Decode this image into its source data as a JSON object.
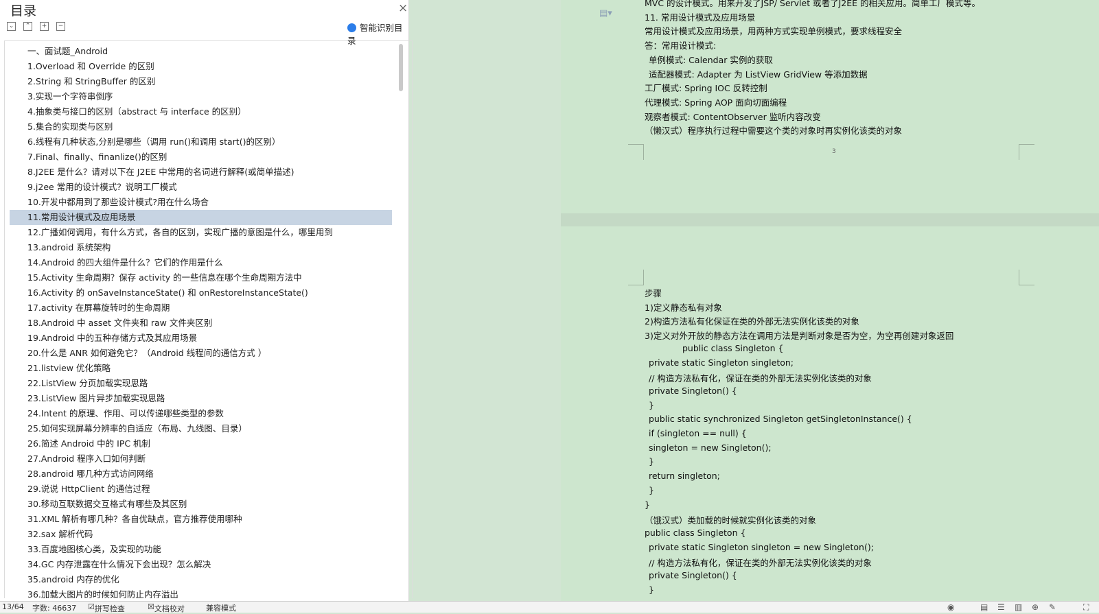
{
  "toc": {
    "title": "目录",
    "close_icon": "×",
    "smart_label": "智能识别目录",
    "toolbar_icons": [
      "collapse-icon",
      "expand-up-icon",
      "plus-icon",
      "minus-icon"
    ],
    "selected_index": 11,
    "items": [
      "一、面试题_Android",
      "1.Overload 和 Override 的区别",
      "2.String  和 StringBuffer 的区别",
      "3.实现一个字符串倒序",
      "4.抽象类与接口的区别（abstract 与 interface 的区别）",
      "5.集合的实现类与区别",
      "6.线程有几种状态,分别是哪些（调用 run()和调用 start()的区别）",
      "7.Final、finally、finanlize()的区别",
      "8.J2EE 是什么？请对以下在 J2EE 中常用的名词进行解释(或简单描述)",
      "9.j2ee 常用的设计模式？说明工厂模式",
      "10.开发中都用到了那些设计模式?用在什么场合",
      "11.常用设计模式及应用场景",
      "12.广播如何调用，有什么方式，各自的区别，实现广播的意图是什么，哪里用到",
      "13.android 系统架构",
      "14.Android 的四大组件是什么？它们的作用是什么",
      "15.Activity 生命周期？保存 activity 的一些信息在哪个生命周期方法中",
      "16.Activity 的  onSaveInstanceState()  和  onRestoreInstanceState()",
      "17.activity 在屏幕旋转时的生命周期",
      "18.Android 中 asset 文件夹和 raw 文件夹区别",
      "19.Android 中的五种存储方式及其应用场景",
      "20.什么是 ANR  如何避免它？（Android 线程间的通信方式  ）",
      "21.listview 优化策略",
      "22.ListView 分页加载实现思路",
      "23.ListView 图片异步加载实现思路",
      "24.Intent 的原理、作用、可以传递哪些类型的参数",
      "25.如何实现屏幕分辨率的自适应（布局、九线图、目录）",
      "26.简述 Android 中的 IPC 机制",
      "27.Android 程序入口如何判断",
      "28.android 哪几种方式访问网络",
      "29.说说 HttpClient 的通信过程",
      "30.移动互联数据交互格式有哪些及其区别",
      "31.XML 解析有哪几种？各自优缺点，官方推荐使用哪种",
      "32.sax 解析代码",
      "33.百度地图核心类，及实现的功能",
      "34.GC 内存泄露在什么情况下会出现？怎么解决",
      "35.android 内存的优化",
      "36.加载大图片的时候如何防止内存溢出"
    ]
  },
  "page1": {
    "page_number": "3",
    "lines": [
      {
        "text": "MVC 的设计模式。用来开发了JSP/ Servlet 或者了J2EE 的相关应用。简单工厂模式等。",
        "indent": 0
      },
      {
        "text": "11.   常用设计模式及应用场景",
        "indent": 0
      },
      {
        "text": "常用设计模式及应用场景，用两种方式实现单例模式，要求线程安全",
        "indent": 0
      },
      {
        "text": "答：常用设计模式:",
        "indent": 0
      },
      {
        "text": "单例模式: Calendar 实例的获取",
        "indent": 1
      },
      {
        "text": "适配器模式: Adapter  为 ListView GridView 等添加数据",
        "indent": 1
      },
      {
        "text": "工厂模式: Spring IOC  反转控制",
        "indent": 0
      },
      {
        "text": "代理模式: Spring AOP  面向切面编程",
        "indent": 0
      },
      {
        "text": "观察者模式: ContentObserver 监听内容改变",
        "indent": 0
      },
      {
        "text": "（懒汉式）程序执行过程中需要这个类的对象时再实例化该类的对象",
        "indent": 0
      }
    ]
  },
  "page2": {
    "lines": [
      {
        "text": "步骤",
        "indent": 0
      },
      {
        "text": "1)定义静态私有对象",
        "indent": 0
      },
      {
        "text": "2)构造方法私有化保证在类的外部无法实例化该类的对象",
        "indent": 0
      },
      {
        "text": "3)定义对外开放的静态方法在调用方法是判断对象是否为空，为空再创建对象返回",
        "indent": 0
      },
      {
        "text": "public class Singleton {",
        "indent": 2
      },
      {
        "text": "private static Singleton singleton;",
        "indent": 1
      },
      {
        "text": "//  构造方法私有化，保证在类的外部无法实例化该类的对象",
        "indent": 1
      },
      {
        "text": "private Singleton() {",
        "indent": 1
      },
      {
        "text": "}",
        "indent": 1
      },
      {
        "text": "public static synchronized Singleton getSingletonInstance() {",
        "indent": 1
      },
      {
        "text": "if (singleton == null) {",
        "indent": 1
      },
      {
        "text": "singleton = new Singleton();",
        "indent": 1
      },
      {
        "text": "}",
        "indent": 1
      },
      {
        "text": "return singleton;",
        "indent": 1
      },
      {
        "text": "}",
        "indent": 1
      },
      {
        "text": "}",
        "indent": 0
      },
      {
        "text": "（饿汉式）类加载的时候就实例化该类的对象",
        "indent": 0
      },
      {
        "text": "public class Singleton {",
        "indent": 0
      },
      {
        "text": "private static Singleton singleton = new Singleton();",
        "indent": 1
      },
      {
        "text": "//  构造方法私有化，保证在类的外部无法实例化该类的对象",
        "indent": 1
      },
      {
        "text": "private Singleton() {",
        "indent": 1
      },
      {
        "text": "}",
        "indent": 1
      }
    ]
  },
  "status": {
    "page": "13/64",
    "word_count": "字数: 46637",
    "spell_check": "拼写检查",
    "doc_proof": "文档校对",
    "compat_mode": "兼容模式"
  },
  "colors": {
    "doc_background": "#cde6ce",
    "selected_item": "#c7d4e3"
  }
}
